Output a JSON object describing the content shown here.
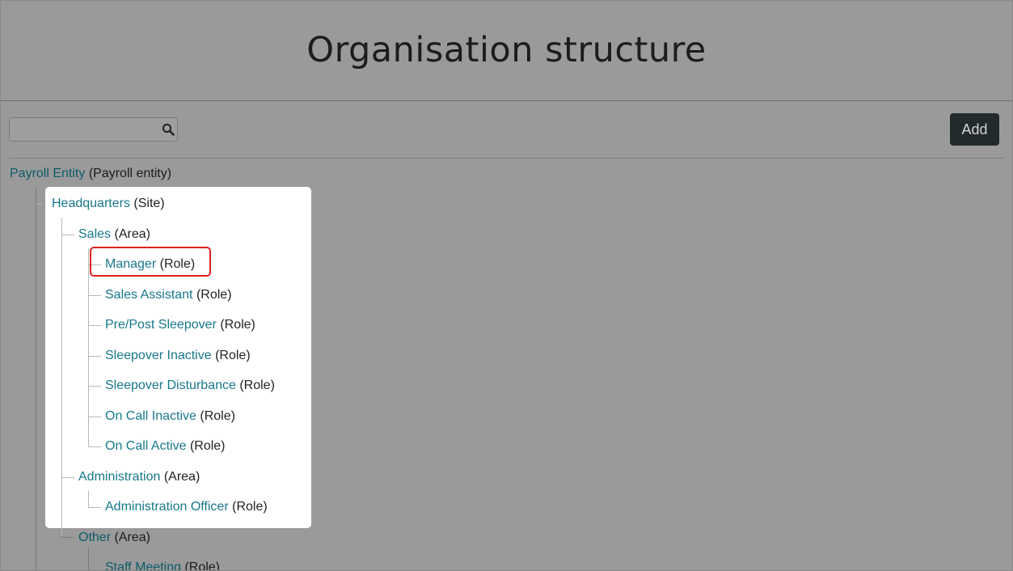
{
  "header": {
    "title": "Organisation structure"
  },
  "search": {
    "value": "",
    "placeholder": ""
  },
  "toolbar": {
    "add_label": "Add"
  },
  "tree": {
    "root": {
      "name": "Payroll Entity",
      "type": "(Payroll entity)"
    },
    "site": {
      "name": "Headquarters",
      "type": "(Site)"
    },
    "areas": [
      {
        "name": "Sales",
        "type": "(Area)",
        "roles": [
          {
            "name": "Manager",
            "type": "(Role)"
          },
          {
            "name": "Sales Assistant",
            "type": "(Role)"
          },
          {
            "name": "Pre/Post Sleepover",
            "type": "(Role)"
          },
          {
            "name": "Sleepover Inactive",
            "type": "(Role)"
          },
          {
            "name": "Sleepover Disturbance",
            "type": "(Role)"
          },
          {
            "name": "On Call Inactive",
            "type": "(Role)"
          },
          {
            "name": "On Call Active",
            "type": "(Role)"
          }
        ]
      },
      {
        "name": "Administration",
        "type": "(Area)",
        "roles": [
          {
            "name": "Administration Officer",
            "type": "(Role)"
          }
        ]
      },
      {
        "name": "Other",
        "type": "(Area)",
        "roles": [
          {
            "name": "Staff Meeting",
            "type": "(Role)"
          }
        ]
      }
    ]
  },
  "icons": {
    "search": "search-icon"
  },
  "colors": {
    "overlay_bg": "#9a9a9a",
    "link": "#17788a",
    "add_button_bg": "#222a2b",
    "highlight_border": "#e0211f"
  }
}
